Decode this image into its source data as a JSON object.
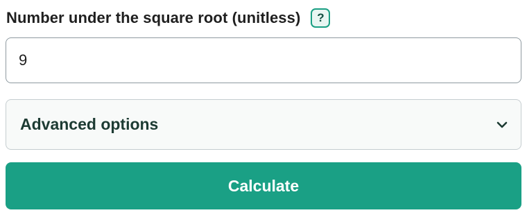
{
  "field": {
    "label": "Number under the square root (unitless)",
    "help_label": "?",
    "value": "9"
  },
  "advanced": {
    "label": "Advanced options",
    "icon": "chevron-down-icon",
    "expanded": false
  },
  "actions": {
    "calculate_label": "Calculate"
  },
  "colors": {
    "accent": "#1aa085",
    "label_text": "#1f1f1f",
    "advanced_text": "#1d3b33",
    "input_border": "#8e9aa0"
  }
}
